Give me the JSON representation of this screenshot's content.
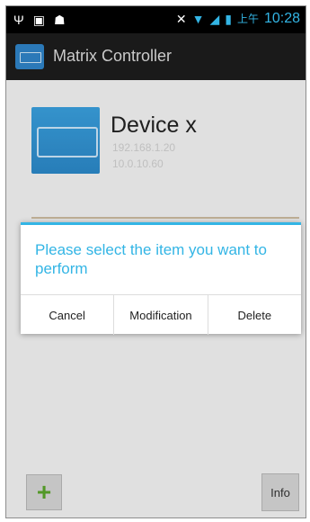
{
  "status_bar": {
    "icons_left": [
      "usb-icon",
      "image-icon",
      "android-icon"
    ],
    "icons_right": [
      "mute-icon",
      "wifi-icon",
      "signal-icon",
      "battery-icon"
    ],
    "ampm": "上午",
    "time": "10:28"
  },
  "action_bar": {
    "title": "Matrix Controller"
  },
  "device": {
    "name": "Device x",
    "line1": "192.168.1.20",
    "line2": "10.0.10.60"
  },
  "dialog": {
    "title": "Please select the item you want to perform",
    "cancel_label": "Cancel",
    "modify_label": "Modification",
    "delete_label": "Delete"
  },
  "bottom": {
    "add_symbol": "+",
    "info_label": "Info"
  },
  "colors": {
    "accent": "#33b5e5",
    "action_bar": "#1d1d1d",
    "add_green": "#5aa52b"
  }
}
